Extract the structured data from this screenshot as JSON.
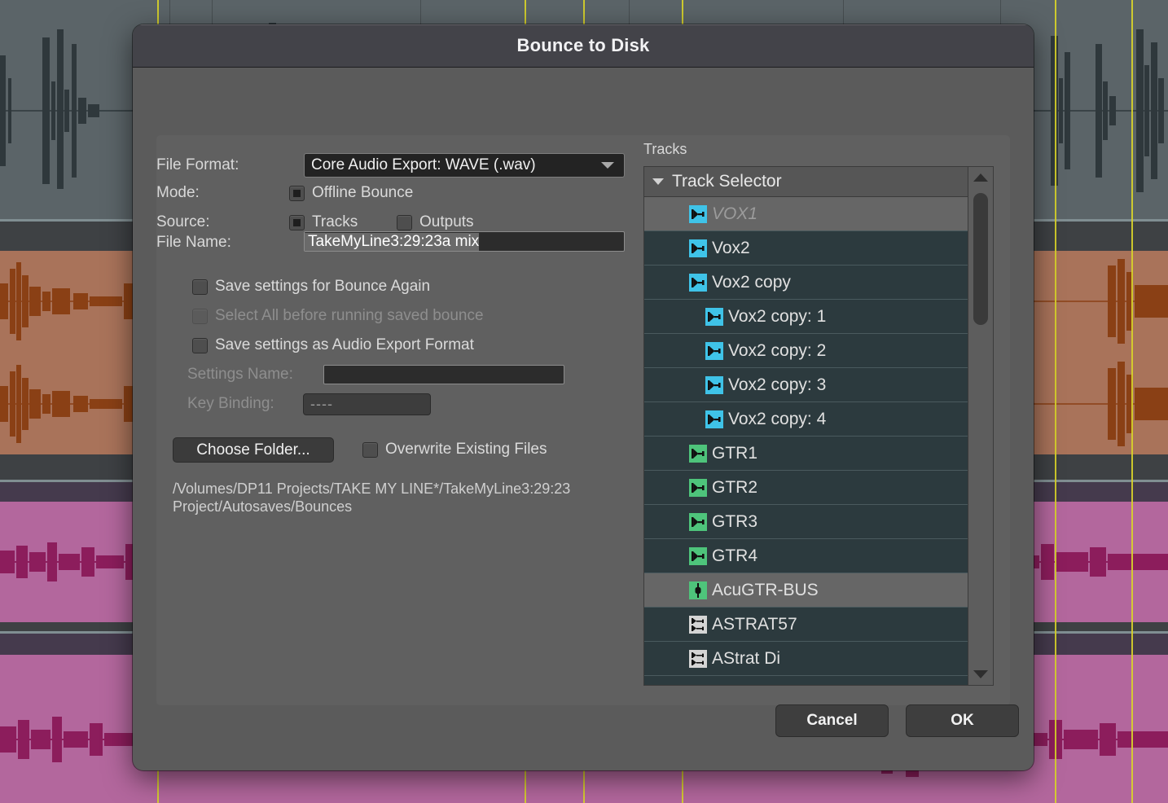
{
  "dialog": {
    "title": "Bounce to Disk",
    "form": {
      "file_format_label": "File Format:",
      "file_format_value": "Core Audio Export: WAVE (.wav)",
      "mode_label": "Mode:",
      "offline_bounce_label": "Offline Bounce",
      "source_label": "Source:",
      "source_tracks_label": "Tracks",
      "source_outputs_label": "Outputs",
      "file_name_label": "File Name:",
      "file_name_value": "TakeMyLine3:29:23a mix",
      "save_bounce_again_label": "Save settings for Bounce Again",
      "select_all_label": "Select All before running saved bounce",
      "save_audio_export_label": "Save settings as Audio Export Format",
      "settings_name_label": "Settings Name:",
      "settings_name_value": "",
      "key_binding_label": "Key Binding:",
      "key_binding_value": "----",
      "choose_folder_label": "Choose Folder...",
      "overwrite_label": "Overwrite Existing Files",
      "bounce_path": "/Volumes/DP11 Projects/TAKE MY LINE*/TakeMyLine3:29:23 Project/Autosaves/Bounces"
    },
    "tracks": {
      "heading": "Tracks",
      "selector_label": "Track Selector",
      "items": [
        {
          "label": "VOX1",
          "icon": "mono-track-icon",
          "color": "#3fc3e8",
          "indent": 0,
          "selected": true,
          "muted": true
        },
        {
          "label": "Vox2",
          "icon": "mono-track-icon",
          "color": "#3fc3e8",
          "indent": 0,
          "selected": false,
          "muted": false
        },
        {
          "label": "Vox2 copy",
          "icon": "mono-track-icon",
          "color": "#3fc3e8",
          "indent": 0,
          "selected": false,
          "muted": false
        },
        {
          "label": "Vox2 copy: 1",
          "icon": "mono-track-icon",
          "color": "#3fc3e8",
          "indent": 1,
          "selected": false,
          "muted": false
        },
        {
          "label": "Vox2 copy: 2",
          "icon": "mono-track-icon",
          "color": "#3fc3e8",
          "indent": 1,
          "selected": false,
          "muted": false
        },
        {
          "label": "Vox2 copy: 3",
          "icon": "mono-track-icon",
          "color": "#3fc3e8",
          "indent": 1,
          "selected": false,
          "muted": false
        },
        {
          "label": "Vox2 copy: 4",
          "icon": "mono-track-icon",
          "color": "#3fc3e8",
          "indent": 1,
          "selected": false,
          "muted": false
        },
        {
          "label": "GTR1",
          "icon": "mono-track-icon",
          "color": "#4ec47b",
          "indent": 0,
          "selected": false,
          "muted": false
        },
        {
          "label": "GTR2",
          "icon": "mono-track-icon",
          "color": "#4ec47b",
          "indent": 0,
          "selected": false,
          "muted": false
        },
        {
          "label": "GTR3",
          "icon": "mono-track-icon",
          "color": "#4ec47b",
          "indent": 0,
          "selected": false,
          "muted": false
        },
        {
          "label": "GTR4",
          "icon": "mono-track-icon",
          "color": "#4ec47b",
          "indent": 0,
          "selected": false,
          "muted": false
        },
        {
          "label": "AcuGTR-BUS",
          "icon": "bus-icon",
          "color": "#4ec47b",
          "indent": 0,
          "selected": true,
          "muted": false
        },
        {
          "label": "ASTRAT57",
          "icon": "stereo-track-icon",
          "color": "#d4d4d4",
          "indent": 0,
          "selected": false,
          "muted": false
        },
        {
          "label": "AStrat Di",
          "icon": "stereo-track-icon",
          "color": "#d4d4d4",
          "indent": 0,
          "selected": false,
          "muted": false
        }
      ]
    },
    "footer": {
      "cancel_label": "Cancel",
      "ok_label": "OK"
    }
  },
  "background": {
    "marker_color": "#d8d22a",
    "tracks": [
      {
        "name": "gray-waveform-track",
        "clip_color": "#5b6468",
        "wave_color": "#2f383c"
      },
      {
        "name": "orange-waveform-track",
        "clip_color": "#a9735a",
        "wave_color": "#8a4015"
      },
      {
        "name": "purple-waveform-track",
        "clip_color": "#b3679d",
        "wave_color": "#8c1d5c"
      },
      {
        "name": "purple-waveform-track-2",
        "clip_color": "#b3679d",
        "wave_color": "#8c1d5c"
      }
    ]
  }
}
